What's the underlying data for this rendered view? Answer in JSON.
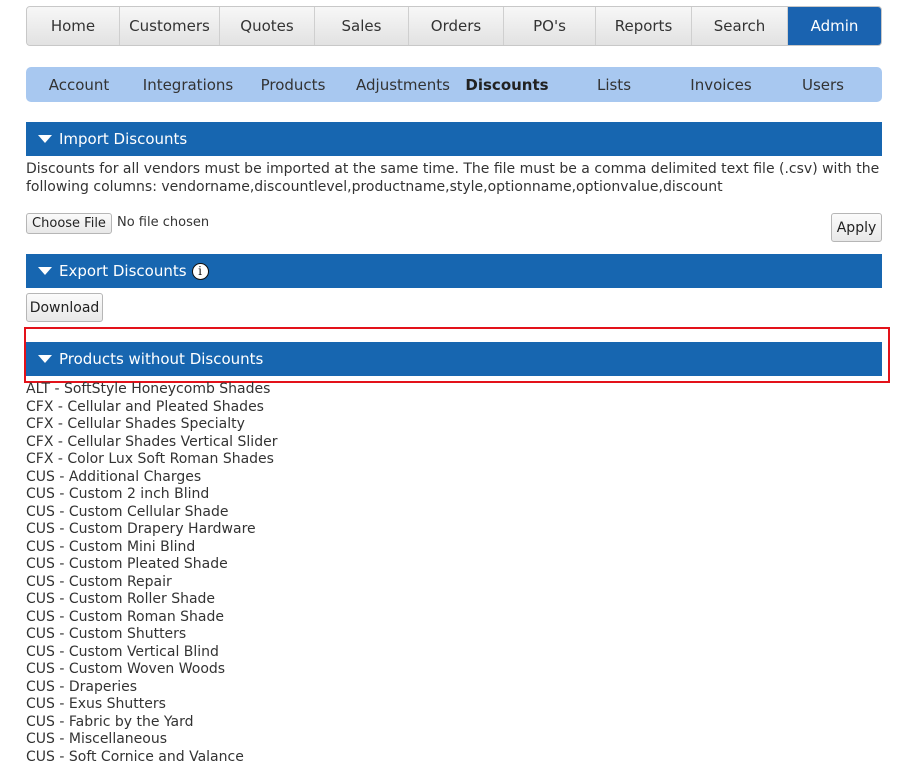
{
  "top_nav": {
    "tabs": [
      {
        "label": "Home"
      },
      {
        "label": "Customers"
      },
      {
        "label": "Quotes"
      },
      {
        "label": "Sales"
      },
      {
        "label": "Orders"
      },
      {
        "label": "PO's"
      },
      {
        "label": "Reports"
      },
      {
        "label": "Search"
      },
      {
        "label": "Admin",
        "active": true
      }
    ]
  },
  "sub_nav": {
    "tabs": [
      {
        "label": "Account"
      },
      {
        "label": "Integrations"
      },
      {
        "label": "Products"
      },
      {
        "label": "Adjustments"
      },
      {
        "label": "Discounts",
        "active": true
      },
      {
        "label": "Lists"
      },
      {
        "label": "Invoices"
      },
      {
        "label": "Users"
      }
    ]
  },
  "import_section": {
    "title": "Import Discounts",
    "description": "Discounts for all vendors must be imported at the same time. The file must be a comma delimited text file (.csv) with the following columns: vendorname,discountlevel,productname,style,optionname,optionvalue,discount",
    "choose_file_label": "Choose File",
    "file_status": "No file chosen",
    "apply_label": "Apply"
  },
  "export_section": {
    "title": "Export Discounts",
    "info_glyph": "i",
    "download_label": "Download"
  },
  "products_section": {
    "title": "Products without Discounts",
    "items": [
      "ALT - SoftStyle Honeycomb Shades",
      "CFX - Cellular and Pleated Shades",
      "CFX - Cellular Shades Specialty",
      "CFX - Cellular Shades Vertical Slider",
      "CFX - Color Lux Soft Roman Shades",
      "CUS - Additional Charges",
      "CUS - Custom 2 inch Blind",
      "CUS - Custom Cellular Shade",
      "CUS - Custom Drapery Hardware",
      "CUS - Custom Mini Blind",
      "CUS - Custom Pleated Shade",
      "CUS - Custom Repair",
      "CUS - Custom Roller Shade",
      "CUS - Custom Roman Shade",
      "CUS - Custom Shutters",
      "CUS - Custom Vertical Blind",
      "CUS - Custom Woven Woods",
      "CUS - Draperies",
      "CUS - Exus Shutters",
      "CUS - Fabric by the Yard",
      "CUS - Miscellaneous",
      "CUS - Soft Cornice and Valance"
    ]
  },
  "colors": {
    "accent": "#1766b0",
    "subnav_bg": "#a8c8f0",
    "highlight": "#e3121a"
  }
}
